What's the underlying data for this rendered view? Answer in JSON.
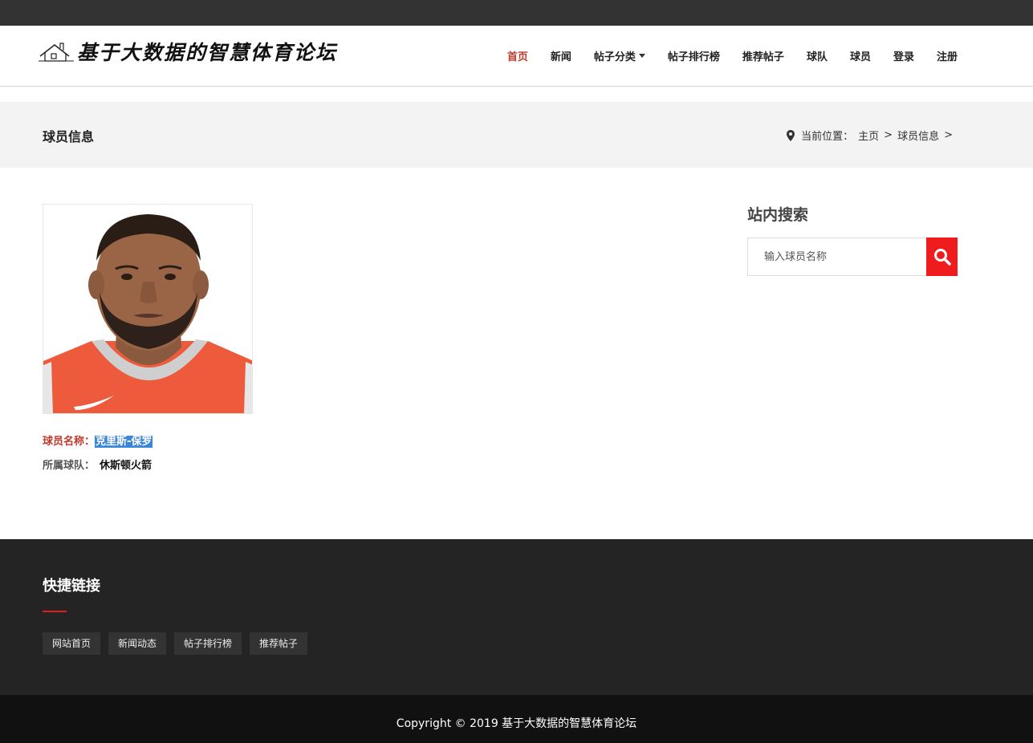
{
  "header": {
    "logo_text": "基于大数据的智慧体育论坛",
    "nav": [
      {
        "label": "首页"
      },
      {
        "label": "新闻"
      },
      {
        "label": "帖子分类"
      },
      {
        "label": "帖子排行榜"
      },
      {
        "label": "推荐帖子"
      },
      {
        "label": "球队"
      },
      {
        "label": "球员"
      },
      {
        "label": "登录"
      },
      {
        "label": "注册"
      }
    ]
  },
  "titlebar": {
    "page_title": "球员信息",
    "breadcrumb_prefix": "当前位置：",
    "crumb_home": "主页",
    "crumb_sep": ">",
    "crumb_current": "球员信息",
    "crumb_end": ">"
  },
  "player": {
    "name_label": "球员名称：",
    "name_value": "克里斯-保罗",
    "team_label": "所属球队：",
    "team_value": "休斯顿火箭"
  },
  "sidebar": {
    "search_title": "站内搜索",
    "search_placeholder": "输入球员名称"
  },
  "footer": {
    "title": "快捷链接",
    "links": [
      {
        "label": "网站首页"
      },
      {
        "label": "新闻动态"
      },
      {
        "label": "帖子排行榜"
      },
      {
        "label": "推荐帖子"
      }
    ],
    "copyright": "Copyright © 2019 基于大数据的智慧体育论坛"
  },
  "colors": {
    "accent": "#c0392b",
    "search_button": "#ee1c1c",
    "footer_bg": "#242424"
  }
}
